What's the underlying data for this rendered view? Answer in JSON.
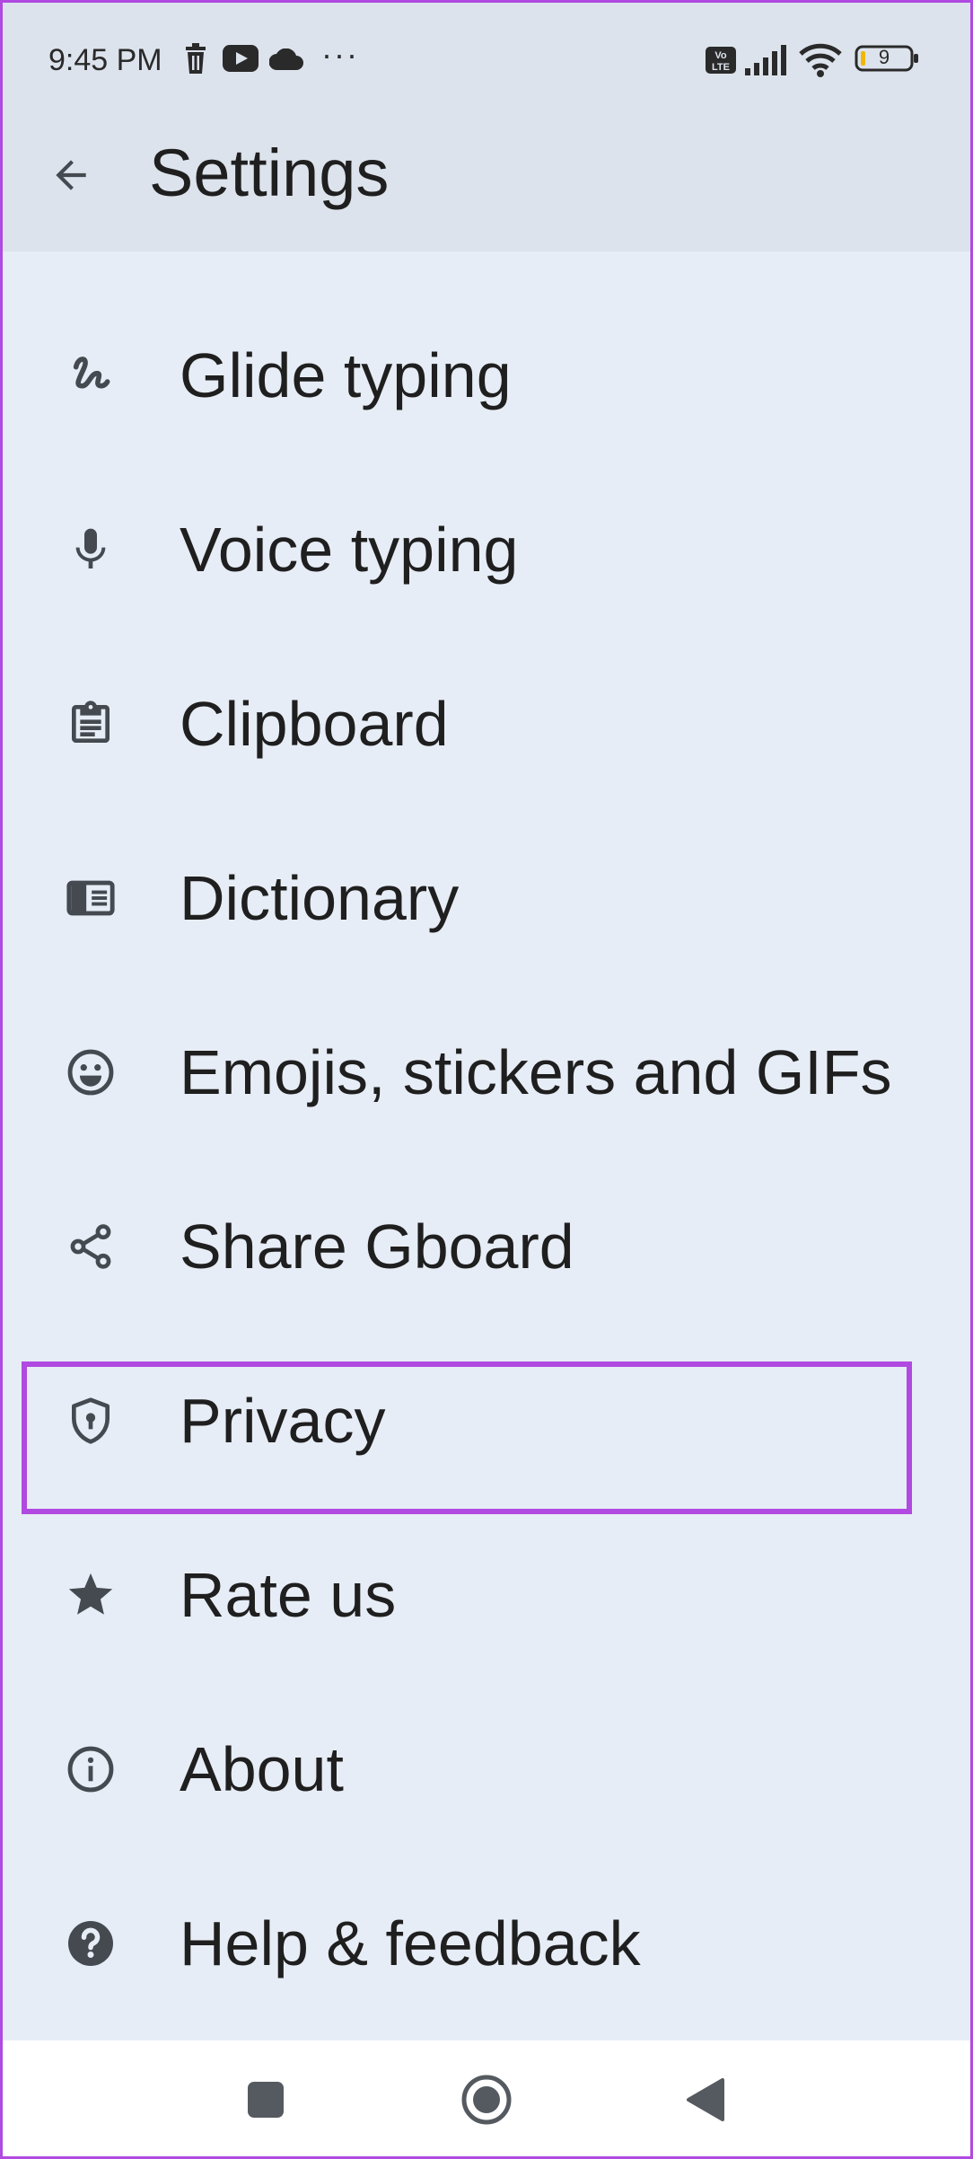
{
  "status_bar": {
    "time": "9:45 PM",
    "more": "···",
    "battery_level": "9",
    "icons": [
      "trash-icon",
      "youtube-icon",
      "cloud-icon",
      "volte-icon",
      "signal-icon",
      "wifi-icon",
      "battery-icon"
    ]
  },
  "header": {
    "title": "Settings",
    "back_icon": "arrow-back-icon"
  },
  "menu": {
    "items": [
      {
        "label": "Glide typing",
        "icon": "glide-typing-icon"
      },
      {
        "label": "Voice typing",
        "icon": "mic-icon"
      },
      {
        "label": "Clipboard",
        "icon": "clipboard-icon"
      },
      {
        "label": "Dictionary",
        "icon": "dictionary-icon"
      },
      {
        "label": "Emojis, stickers and GIFs",
        "icon": "emoji-icon"
      },
      {
        "label": "Share Gboard",
        "icon": "share-icon"
      },
      {
        "label": "Privacy",
        "icon": "shield-icon"
      },
      {
        "label": "Rate us",
        "icon": "star-icon"
      },
      {
        "label": "About",
        "icon": "info-icon"
      },
      {
        "label": "Help & feedback",
        "icon": "help-icon"
      }
    ],
    "highlighted_item": "Privacy"
  },
  "nav_bar": {
    "buttons": [
      "recents-button",
      "home-button",
      "back-button"
    ]
  },
  "colors": {
    "background": "#e7edf6",
    "header_background": "#dde3ec",
    "highlight": "#b04ae0",
    "icon": "#444a50",
    "text": "#1f1f1f"
  }
}
